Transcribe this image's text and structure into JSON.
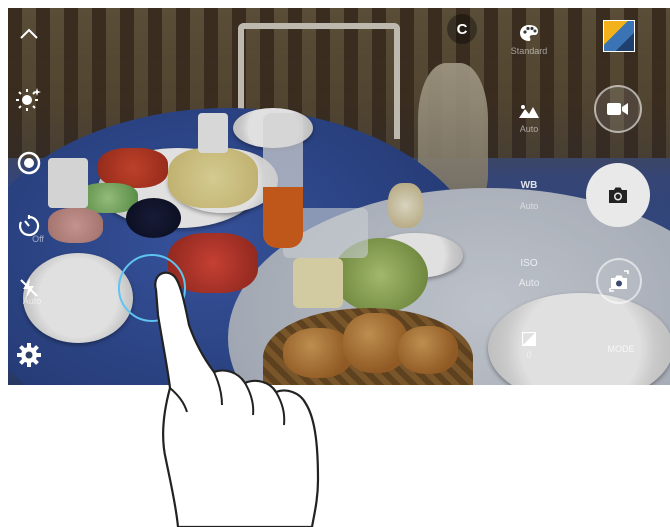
{
  "left_toolbar": {
    "collapse_icon": "chevron-up-icon",
    "effects_icon": "sparkle-icon",
    "live_focus_icon": "target-icon",
    "timer_label": "Off",
    "flash_label": "Auto",
    "settings_icon": "gear-icon"
  },
  "top_bar": {
    "mode_letter": "C",
    "gallery_icon": "gallery-thumbnail"
  },
  "right_settings": {
    "color_filter_label": "Standard",
    "scene_label": "Auto",
    "wb_title": "WB",
    "wb_value": "Auto",
    "iso_title": "ISO",
    "iso_value": "Auto",
    "ev_value": "0",
    "mode_label": "MODE"
  },
  "controls": {
    "record_icon": "video-camera-icon",
    "shutter_icon": "camera-icon",
    "switch_icon": "switch-camera-icon"
  },
  "colors": {
    "focus_ring": "#5ec4f2",
    "shutter_bg": "#e9e9e9"
  }
}
